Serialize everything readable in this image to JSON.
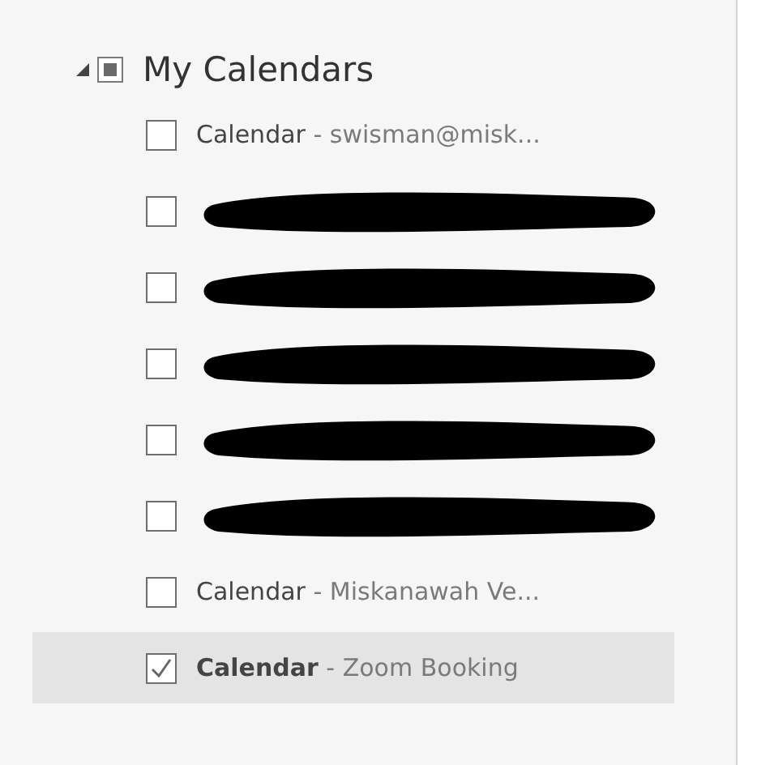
{
  "group": {
    "label": "My Calendars",
    "expanded": true,
    "partial": true
  },
  "calendars": [
    {
      "kind": "text",
      "name": "Calendar",
      "owner": " - swisman@misk...",
      "checked": false,
      "selected": false
    },
    {
      "kind": "redacted",
      "checked": false,
      "selected": false
    },
    {
      "kind": "redacted",
      "checked": false,
      "selected": false
    },
    {
      "kind": "redacted",
      "checked": false,
      "selected": false
    },
    {
      "kind": "redacted",
      "checked": false,
      "selected": false
    },
    {
      "kind": "redacted",
      "checked": false,
      "selected": false
    },
    {
      "kind": "text",
      "name": "Calendar",
      "owner": " - Miskanawah Ve...",
      "checked": false,
      "selected": false
    },
    {
      "kind": "text",
      "name": "Calendar",
      "owner": " - Zoom Booking",
      "checked": true,
      "selected": true
    }
  ]
}
